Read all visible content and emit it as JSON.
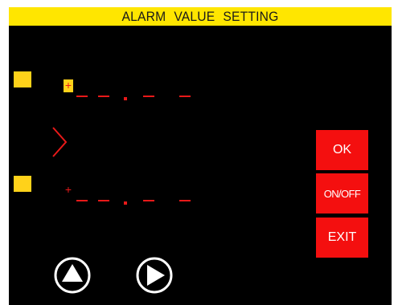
{
  "header": {
    "title": "ALARM  VALUE  SETTING"
  },
  "alarm_rows": [
    {
      "sign": "+",
      "value_display": "–– . ––",
      "cursor_active": true
    },
    {
      "sign": "+",
      "value_display": "–– . ––",
      "cursor_active": false
    }
  ],
  "buttons": {
    "ok_label": "OK",
    "onoff_label": "ON/OFF",
    "exit_label": "EXIT"
  },
  "icons": {
    "row_selector": "chevron-right-icon",
    "nav_up": "up-arrow-circle-icon",
    "nav_right": "right-arrow-circle-icon"
  },
  "colors": {
    "screen_background": "#000000",
    "title_bar": "#ffe600",
    "marker": "#ffd21a",
    "digits": "#e81919",
    "button": "#f40f0f",
    "button_text": "#ffffff"
  }
}
